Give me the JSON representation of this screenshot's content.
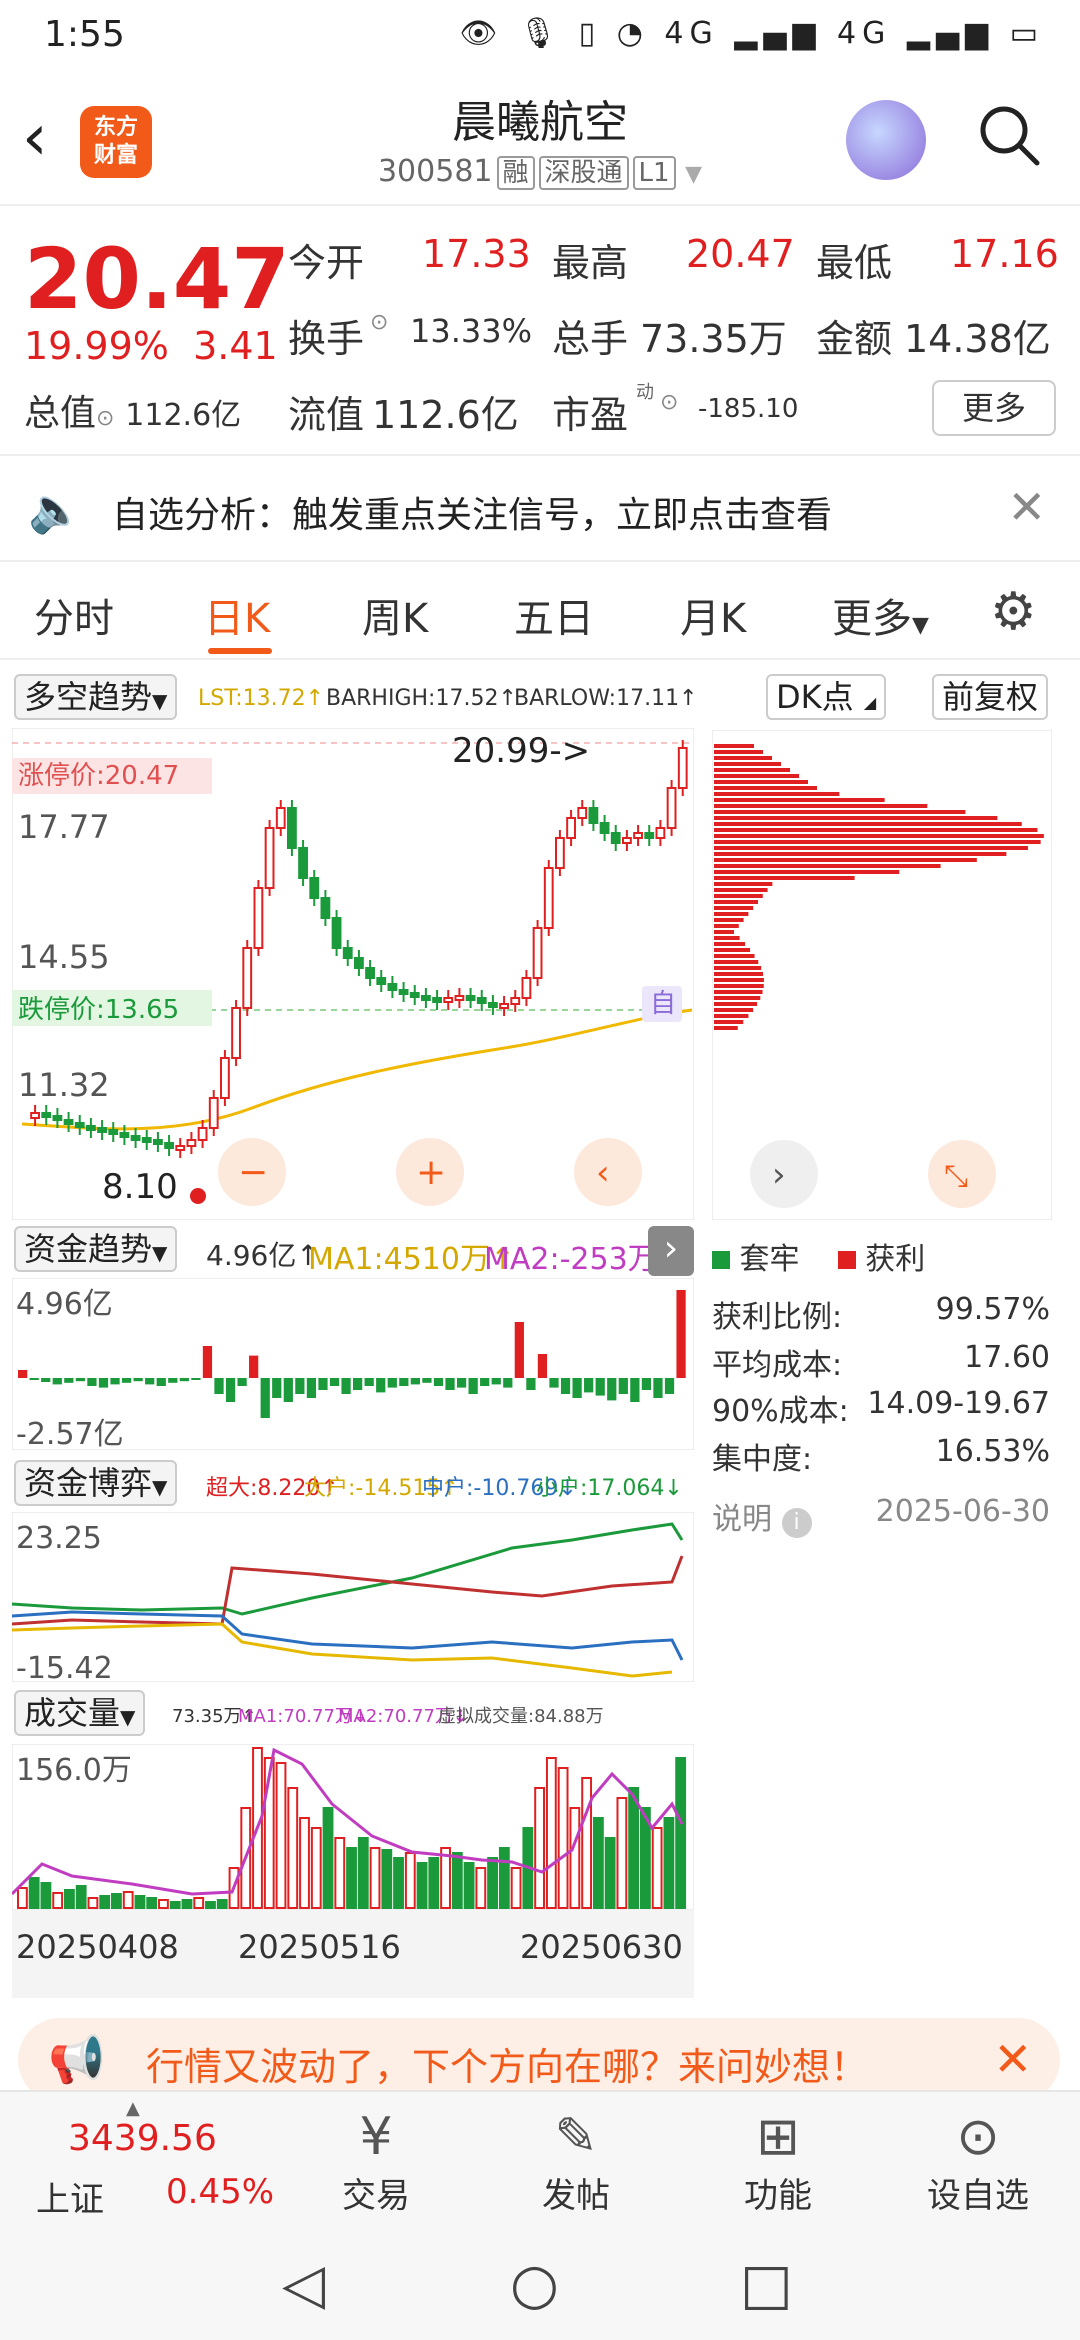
{
  "status_bar": {
    "time": "1:55",
    "icons": "👁 🎙 ▯ ◔ 4G ▂▄▆ 4G ▂▄▆ ▭"
  },
  "header": {
    "back_icon": "chevron-left-icon",
    "logo_text_1": "东方",
    "logo_text_2": "财富",
    "stock_name": "晨曦航空",
    "stock_code": "300581",
    "tags": [
      "融",
      "深股通",
      "L1"
    ]
  },
  "quote": {
    "price": "20.47",
    "pct": "19.99%",
    "change": "3.41",
    "open_label": "今开",
    "open": "17.33",
    "high_label": "最高",
    "high": "20.47",
    "low_label": "最低",
    "low": "17.16",
    "turnover_label": "换手",
    "turnover": "13.33%",
    "volume_label": "总手",
    "volume": "73.35万",
    "amount_label": "金额",
    "amount": "14.38亿",
    "total_cap_label": "总值",
    "total_cap": "112.6亿",
    "float_cap_label": "流值",
    "float_cap": "112.6亿",
    "pe_label": "市盈",
    "pe_sup": "动",
    "pe": "-185.10",
    "more_button": "更多"
  },
  "banner": {
    "text": "自选分析：触发重点关注信号，立即点击查看"
  },
  "tabs": [
    "分时",
    "日K",
    "周K",
    "五日",
    "月K",
    "更多"
  ],
  "chart": {
    "indicator_select": "多空趋势",
    "lst": "LST:13.72↑",
    "barhigh": "BARHIGH:17.52↑",
    "barlow": "BARLOW:17.11↑",
    "dk_button": "DK点",
    "adj_button": "前复权",
    "limit_up": "涨停价:20.47",
    "limit_down": "跌停价:13.65",
    "y_labels": [
      "17.77",
      "14.55",
      "11.32",
      "8.10"
    ],
    "high_mark": "20.99->",
    "low_mark": "8.10",
    "auto_tag": "自",
    "fund_trend_select": "资金趋势",
    "fund_trend_values": [
      "4.96亿↑",
      "MA1:4510万↑",
      "MA2:-253万↑"
    ],
    "fund_trend_y": [
      "4.96亿",
      "-2.57亿"
    ],
    "fund_game_select": "资金博弈",
    "fund_game_values": [
      "超大:8.220↑",
      "大户:-14.515↑",
      "中户:-10.769↓",
      "小户:17.064↓"
    ],
    "fund_game_y": [
      "23.25",
      "-15.42"
    ],
    "volume_select": "成交量",
    "volume_values": [
      "73.35万↑",
      "MA1:70.77万↓",
      "MA2:70.77万↓",
      "虚拟成交量:84.88万"
    ],
    "volume_y": "156.0万",
    "dates": [
      "20250408",
      "20250516",
      "20250630"
    ]
  },
  "chips": {
    "legend_trap": "套牢",
    "legend_profit": "获利",
    "stats": [
      {
        "label": "获利比例:",
        "value": "99.57%"
      },
      {
        "label": "平均成本:",
        "value": "17.60"
      },
      {
        "label": "90%成本:",
        "value": "14.09-19.67"
      },
      {
        "label": "集中度:",
        "value": "16.53%"
      }
    ],
    "note_label": "说明",
    "note_date": "2025-06-30"
  },
  "ad": {
    "text": "行情又波动了，下个方向在哪？来问妙想！"
  },
  "bottom_nav": {
    "index_value": "3439.56",
    "index_name": "上证",
    "index_pct": "0.45%",
    "items": [
      "交易",
      "发帖",
      "功能",
      "设自选"
    ]
  },
  "colors": {
    "accent": "#f25a1a",
    "up": "#e02020",
    "down": "#1a9a3a"
  }
}
